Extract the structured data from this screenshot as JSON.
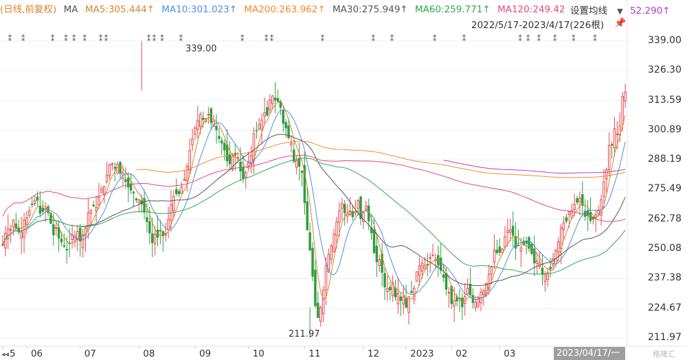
{
  "legend": {
    "prefix": "(日线,前复权)",
    "ma_label": "MA",
    "items": [
      {
        "text": "MA5:305.444↑",
        "color": "#d6852a"
      },
      {
        "text": "MA10:301.023↑",
        "color": "#4f8fe0"
      },
      {
        "text": "MA200:263.962↑",
        "color": "#f08a2c"
      },
      {
        "text": "MA30:275.949↑",
        "color": "#555555"
      },
      {
        "text": "MA60:259.771↑",
        "color": "#2fa84a"
      },
      {
        "text": "MA120:249.42",
        "color": "#e8467c"
      }
    ],
    "settings_label": "设置均线",
    "ma_extra": "52.290↑",
    "range_text": "2022/5/17-2023/4/17(226根)"
  },
  "annotations": {
    "high_label": "339.00",
    "low_label": "211.97",
    "date_tip": "2023/04/17/一",
    "watermark": "格隆汇"
  },
  "chart_data": {
    "type": "candlestick",
    "y_ticks": [
      "339.00",
      "326.30",
      "313.59",
      "300.89",
      "288.19",
      "275.49",
      "262.78",
      "250.08",
      "237.38",
      "224.67",
      "211.97"
    ],
    "x_ticks": [
      "5",
      "06",
      "07",
      "08",
      "09",
      "10",
      "11",
      "12",
      "2023",
      "02",
      "03"
    ],
    "ylim": [
      211.97,
      339.0
    ],
    "high": 339.0,
    "low": 211.97,
    "colors": {
      "up": "#e8474b",
      "down": "#2e9e3e",
      "ma5": "#d6852a",
      "ma10": "#4f8fe0",
      "ma30": "#555555",
      "ma60": "#2fa84a",
      "ma120": "#e8467c",
      "ma200": "#f08a2c",
      "ma250": "#b33ec2"
    },
    "closes": [
      252.0,
      256.8,
      258.6,
      258.5,
      262.4,
      258.8,
      257.4,
      257.3,
      262.4,
      263.4,
      266.4,
      269.2,
      270.7,
      270.9,
      265.3,
      266.2,
      267.3,
      265.6,
      261.0,
      256.1,
      259.3,
      254.7,
      253.1,
      251.3,
      249.8,
      252.6,
      256.1,
      255.7,
      257.6,
      253.5,
      256.1,
      258.8,
      265.5,
      266.5,
      268.4,
      267.9,
      272.3,
      275.9,
      276.9,
      281.6,
      286.2,
      286.7,
      284.5,
      286.4,
      282.5,
      282.7,
      279.0,
      276.6,
      275.3,
      274.1,
      271.1,
      271.2,
      269.3,
      265.8,
      261.8,
      256.9,
      252.8,
      256.4,
      255.1,
      257.9,
      255.7,
      256.7,
      262.7,
      269.1,
      272.6,
      273.7,
      273.7,
      276.6,
      279.9,
      285.5,
      292.2,
      297.2,
      301.8,
      305.0,
      307.6,
      305.5,
      305.9,
      307.7,
      304.2,
      304.8,
      301.1,
      297.3,
      295.4,
      292.4,
      287.8,
      286.6,
      289.7,
      290.2,
      289.2,
      283.4,
      280.3,
      282.8,
      287.4,
      290.2,
      299.4,
      300.8,
      303.5,
      305.3,
      308.4,
      307.3,
      313.9,
      315.6,
      313.8,
      313.2,
      310.7,
      303.8,
      301.8,
      297.6,
      295.4,
      287.5,
      287.8,
      285.5,
      282.8,
      269.9,
      258.2,
      249.6,
      238.4,
      225.8,
      220.7,
      225.0,
      232.4,
      242.8,
      247.8,
      251.4,
      256.5,
      261.7,
      266.5,
      269.4,
      265.6,
      265.1,
      266.1,
      263.8,
      266.1,
      270.8,
      263.1,
      265.7,
      268.5,
      262.0,
      257.0,
      248.5,
      244.6,
      245.5,
      240.1,
      233.8,
      233.2,
      232.6,
      235.8,
      229.6,
      231.1,
      228.1,
      229.6,
      225.2,
      229.7,
      231.3,
      233.3,
      240.4,
      242.9,
      244.0,
      243.1,
      243.3,
      246.4,
      247.4,
      245.8,
      243.4,
      241.0,
      237.9,
      232.9,
      231.5,
      226.7,
      228.0,
      227.8,
      228.7,
      225.3,
      229.7,
      233.3,
      230.4,
      227.2,
      227.3,
      229.0,
      231.6,
      232.3,
      235.2,
      239.3,
      242.4,
      249.6,
      248.5,
      248.7,
      250.1,
      255.3,
      258.1,
      258.3,
      256.0,
      250.4,
      251.6,
      250.5,
      251.8,
      252.5,
      250.4,
      248.1,
      244.1,
      245.0,
      244.1,
      239.2,
      239.3,
      239.9,
      241.5,
      245.9,
      249.4,
      253.2,
      259.2,
      261.3,
      262.0,
      266.1,
      266.5,
      269.2,
      270.1,
      271.8,
      268.7,
      264.0,
      264.6,
      262.3,
      262.9,
      264.7,
      266.7,
      271.2,
      278.8,
      284.0,
      294.4,
      294.6,
      301.6,
      299.3,
      302.8,
      315.3,
      317.3
    ]
  }
}
